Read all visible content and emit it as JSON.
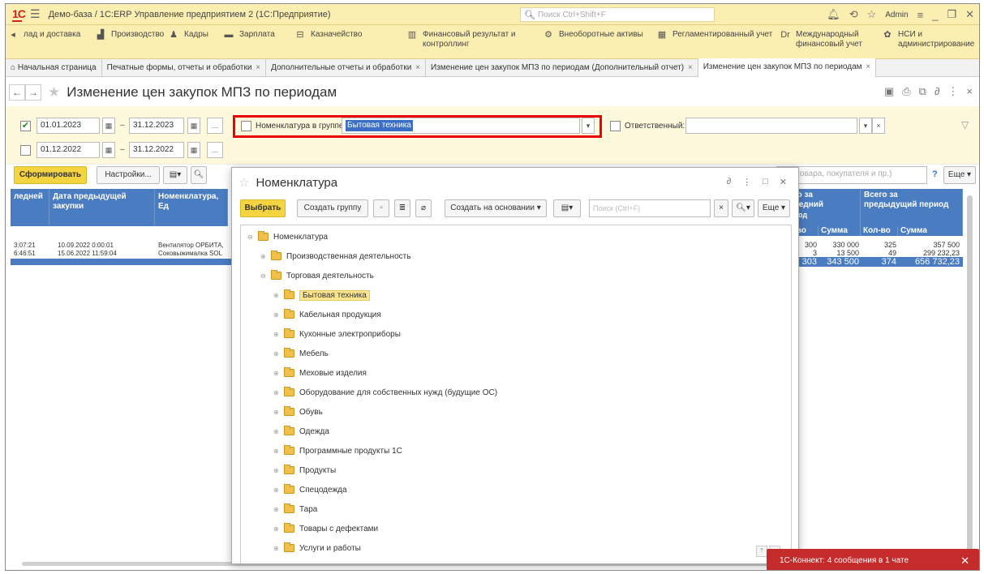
{
  "app": {
    "title": "Демо-база / 1С:ERP Управление предприятием 2 (1С:Предприятие)",
    "logo": "1С",
    "search_placeholder": "Поиск Ctrl+Shift+F",
    "user": "Admin"
  },
  "sections": [
    {
      "label": "лад и доставка",
      "icon": "warehouse-icon"
    },
    {
      "label": "Производство",
      "icon": "factory-icon"
    },
    {
      "label": "Кадры",
      "icon": "people-icon"
    },
    {
      "label": "Зарплата",
      "icon": "money-icon"
    },
    {
      "label": "Казначейство",
      "icon": "treasury-icon"
    },
    {
      "label": "Финансовый результат и",
      "label2": "контроллинг",
      "icon": "chart-icon"
    },
    {
      "label": "Внеоборотные активы",
      "icon": "assets-icon"
    },
    {
      "label": "Регламентированный учет",
      "icon": "calculator-icon"
    },
    {
      "label": "Международный",
      "label2": "финансовый учет",
      "icon": "intl-icon"
    },
    {
      "label": "НСИ и",
      "label2": "администрирование",
      "icon": "gear-icon"
    }
  ],
  "tabs": [
    {
      "label": "Начальная страница",
      "closable": false
    },
    {
      "label": "Печатные формы, отчеты и обработки",
      "closable": true
    },
    {
      "label": "Дополнительные отчеты и обработки",
      "closable": true
    },
    {
      "label": "Изменение цен закупок МПЗ по периодам (Дополнительный отчет)",
      "closable": true
    },
    {
      "label": "Изменение цен закупок МПЗ по периодам",
      "closable": true,
      "active": true
    }
  ],
  "form": {
    "title": "Изменение цен закупок МПЗ по периодам",
    "period1": {
      "checked": true,
      "from": "01.01.2023",
      "to": "31.12.2023"
    },
    "period2": {
      "checked": false,
      "from": "01.12.2022",
      "to": "31.12.2022"
    },
    "group_filter": {
      "label": "Номенклатура в группе:",
      "value": "Бытовая техника",
      "checked": false
    },
    "responsible": {
      "label": "Ответственный:",
      "value": "",
      "checked": false
    },
    "generate_button": "Сформировать",
    "settings_button": "Настройки...",
    "search_hint": "ние товара, покупателя и пр.)",
    "more_button": "Еще",
    "help": "?"
  },
  "grid": {
    "headers": {
      "col1": "ледней",
      "col2": "Дата предыдущей закупки",
      "col3": "Номенклатура, Ед",
      "col4_line1": "его за",
      "col4_line2": "следний",
      "col4_line3": "риод",
      "col5_line1": "Всего за",
      "col5_line2": "предыдущий период",
      "sub_qty": "л-во",
      "sub_sum": "Сумма",
      "sub_qty2": "Кол-во",
      "sub_sum2": "Сумма"
    },
    "rows": [
      {
        "time": "3:07:21",
        "date": "10.09.2022 0:00:01",
        "item": "Вентилятор ОРБИТА,",
        "qty": "300",
        "sum": "330 000",
        "qty2": "325",
        "sum2": "357 500"
      },
      {
        "time": "6:46:51",
        "date": "15.06.2022 11:59:04",
        "item": "Соковыжималка SOL",
        "qty": "3",
        "sum": "13 500",
        "qty2": "49",
        "sum2": "299 232,23"
      }
    ],
    "totals": {
      "qty": "303",
      "sum": "343 500",
      "qty2": "374",
      "sum2": "656 732,23"
    }
  },
  "modal": {
    "title": "Номенклатура",
    "select_button": "Выбрать",
    "create_group_button": "Создать группу",
    "create_based_button": "Создать на основании",
    "search_placeholder": "Поиск (Ctrl+F)",
    "more_button": "Еще",
    "help": "?",
    "tree": [
      {
        "label": "Номенклатура",
        "level": 0,
        "expanded": true
      },
      {
        "label": "Производственная деятельность",
        "level": 1
      },
      {
        "label": "Торговая деятельность",
        "level": 1,
        "expanded": true
      },
      {
        "label": "Бытовая техника",
        "level": 2,
        "selected": true
      },
      {
        "label": "Кабельная продукция",
        "level": 2
      },
      {
        "label": "Кухонные электроприборы",
        "level": 2
      },
      {
        "label": "Мебель",
        "level": 2
      },
      {
        "label": "Меховые изделия",
        "level": 2
      },
      {
        "label": "Оборудование для собственных нужд (будущие ОС)",
        "level": 2
      },
      {
        "label": "Обувь",
        "level": 2
      },
      {
        "label": "Одежда",
        "level": 2
      },
      {
        "label": "Программные продукты 1С",
        "level": 2
      },
      {
        "label": "Продукты",
        "level": 2
      },
      {
        "label": "Спецодежда",
        "level": 2
      },
      {
        "label": "Тара",
        "level": 2
      },
      {
        "label": "Товары с дефектами",
        "level": 2
      },
      {
        "label": "Услуги и работы",
        "level": 2
      }
    ]
  },
  "notification": {
    "text": "1С-Коннект: 4 сообщения в 1 чате"
  }
}
